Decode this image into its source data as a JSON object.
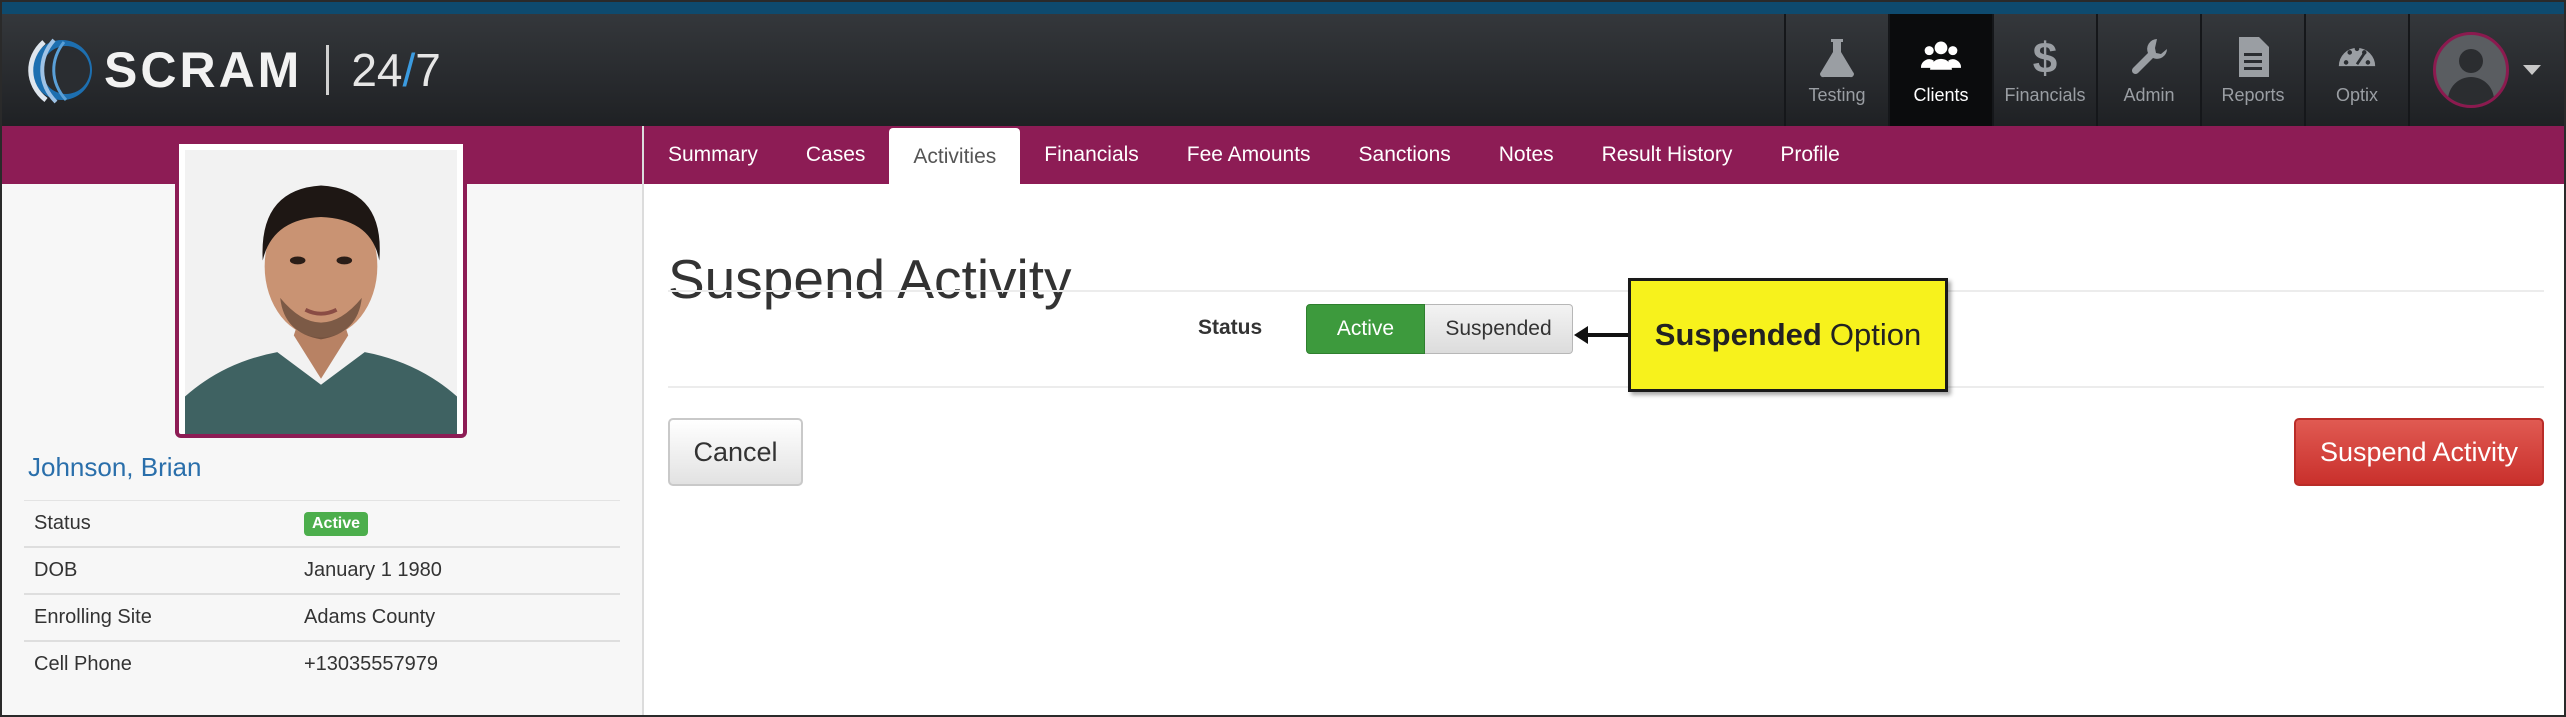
{
  "brand": {
    "name": "SCRAM",
    "suffix_a": "24",
    "suffix_slash": "/",
    "suffix_b": "7",
    "accent": "#8d1c55"
  },
  "nav": {
    "items": [
      {
        "label": "Testing",
        "icon": "flask-icon"
      },
      {
        "label": "Clients",
        "icon": "users-icon",
        "active": true
      },
      {
        "label": "Financials",
        "icon": "dollar-icon"
      },
      {
        "label": "Admin",
        "icon": "wrench-icon"
      },
      {
        "label": "Reports",
        "icon": "document-icon"
      },
      {
        "label": "Optix",
        "icon": "gauge-icon"
      }
    ]
  },
  "client": {
    "name": "Johnson, Brian",
    "fields": [
      {
        "label": "Status",
        "value": "Active"
      },
      {
        "label": "DOB",
        "value": "January 1 1980"
      },
      {
        "label": "Enrolling Site",
        "value": "Adams County"
      },
      {
        "label": "Cell Phone",
        "value": "+13035557979"
      }
    ]
  },
  "tabs": [
    "Summary",
    "Cases",
    "Activities",
    "Financials",
    "Fee Amounts",
    "Sanctions",
    "Notes",
    "Result History",
    "Profile"
  ],
  "active_tab": "Activities",
  "page": {
    "title": "Suspend Activity",
    "status_label": "Status",
    "status_options": [
      "Active",
      "Suspended"
    ],
    "status_selected": "Active",
    "cancel_label": "Cancel",
    "submit_label": "Suspend Activity"
  },
  "callout": {
    "bold": "Suspended",
    "rest": "Option"
  }
}
